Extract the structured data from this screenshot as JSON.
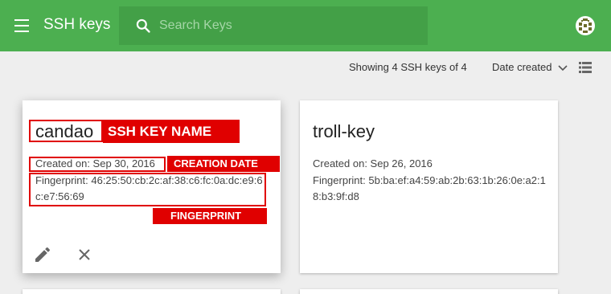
{
  "header": {
    "title": "SSH keys",
    "search_placeholder": "Search Keys",
    "search_value": ""
  },
  "toolbar": {
    "status": "Showing 4 SSH keys of 4",
    "sort_label": "Date created"
  },
  "cards": [
    {
      "name": "candao",
      "created": "Created on: Sep 30, 2016",
      "fingerprint": "Fingerprint: 46:25:50:cb:2c:af:38:c6:fc:0a:dc:e9:6c:e7:56:69",
      "annotations": {
        "name": "SSH KEY NAME",
        "date": "CREATION DATE",
        "fingerprint": "FINGERPRINT"
      }
    },
    {
      "name": "troll-key",
      "created": "Created on: Sep 26, 2016",
      "fingerprint": "Fingerprint: 5b:ba:ef:a4:59:ab:2b:63:1b:26:0e:a2:18:b3:9f:d8"
    }
  ],
  "colors": {
    "header_bg": "#4caf50",
    "search_bg": "#43a047",
    "annotation_red": "#e00000"
  }
}
